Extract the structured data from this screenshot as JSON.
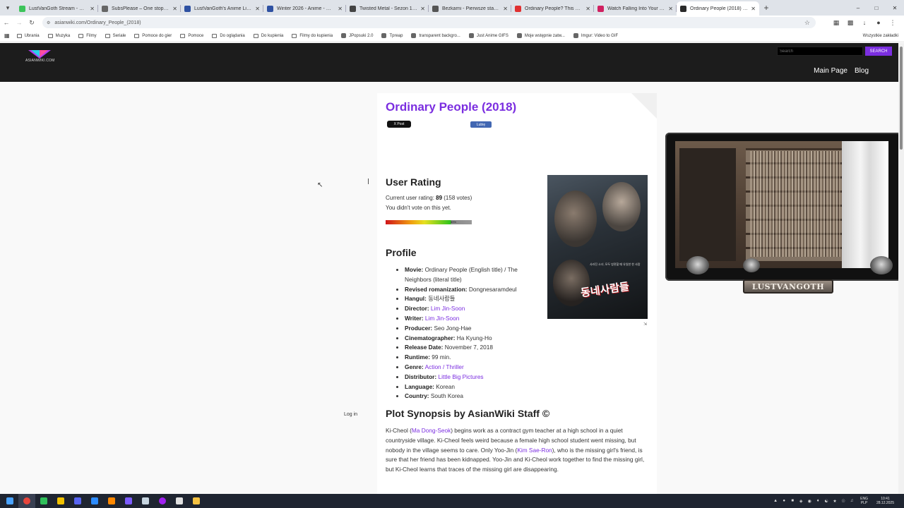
{
  "browser": {
    "tabs": [
      {
        "title": "LustVanGoth Stream - Watch L",
        "color": "#3cc45a",
        "active": false
      },
      {
        "title": "SubsPlease – One stop shop fo",
        "color": "#666666",
        "active": false
      },
      {
        "title": "LustVanGoth's Anime List - My",
        "color": "#2e51a2",
        "active": false
      },
      {
        "title": "Winter 2026 - Anime - MyAnim",
        "color": "#2e51a2",
        "active": false
      },
      {
        "title": "Twisted Metal - Sezon 1 Odcin",
        "color": "#444444",
        "active": false
      },
      {
        "title": "Bezkarni - Pierwsze starcie / Th",
        "color": "#555555",
        "active": false
      },
      {
        "title": "Ordinary People? This Hero PU",
        "color": "#e03030",
        "active": false
      },
      {
        "title": "Watch Falling Into Your Smile E",
        "color": "#d02060",
        "active": false
      },
      {
        "title": "Ordinary People (2018) - Asian",
        "color": "#2a2a2a",
        "active": true
      }
    ],
    "new_tab": "+",
    "url": "asianwiki.com/Ordinary_People_(2018)",
    "bookmarks": [
      {
        "label": "Ubrania",
        "type": "folder"
      },
      {
        "label": "Muzyka",
        "type": "folder"
      },
      {
        "label": "Filmy",
        "type": "folder"
      },
      {
        "label": "Seriale",
        "type": "folder"
      },
      {
        "label": "Pomoce do gier",
        "type": "folder"
      },
      {
        "label": "Pomoce",
        "type": "folder"
      },
      {
        "label": "Do oglądania",
        "type": "folder"
      },
      {
        "label": "Do kupienia",
        "type": "folder"
      },
      {
        "label": "Filmy do kupienia",
        "type": "folder"
      },
      {
        "label": "JPopsuki 2.0",
        "type": "site"
      },
      {
        "label": "Tpreap",
        "type": "site"
      },
      {
        "label": "transparent backgro...",
        "type": "site"
      },
      {
        "label": "Just Anime GIFS",
        "type": "site"
      },
      {
        "label": "Moje wstępnie zatw...",
        "type": "site"
      },
      {
        "label": "Imgur: Video to GIF",
        "type": "site"
      }
    ],
    "bookmarks_other": "Wszystkie zakładki"
  },
  "site": {
    "logo_text": "ASIANWIKI.COM",
    "search_placeholder": "Search",
    "search_button": "SEARCH",
    "nav": [
      "Main Page",
      "Blog"
    ],
    "login": "Log in"
  },
  "article": {
    "title": "Ordinary People (2018)",
    "share_x": "X Post",
    "share_fb": "Lubię",
    "user_rating_heading": "User Rating",
    "rating_line_prefix": "Current user rating: ",
    "rating_value": "89",
    "rating_votes": " (158 votes)",
    "vote_status": "You didn't vote on this yet.",
    "rating_bar_label": "89%",
    "rating_fraction": 0.89,
    "poster_text": "동네사람들",
    "poster_tagline": "사라진 소녀, 모두 방관할 때 유일한 한 사람",
    "profile_heading": "Profile",
    "profile": [
      {
        "key": "Movie:",
        "value": "Ordinary People (English title) / The Neighbors (literal title)",
        "link": false
      },
      {
        "key": "Revised romanization:",
        "value": "Dongnesaramdeul",
        "link": false
      },
      {
        "key": "Hangul:",
        "value": "동네사람들",
        "link": false
      },
      {
        "key": "Director:",
        "value": "Lim Jin-Soon",
        "link": true
      },
      {
        "key": "Writer:",
        "value": "Lim Jin-Soon",
        "link": true
      },
      {
        "key": "Producer:",
        "value": "Seo Jong-Hae",
        "link": false
      },
      {
        "key": "Cinematographer:",
        "value": "Ha Kyung-Ho",
        "link": false
      },
      {
        "key": "Release Date:",
        "value": "November 7, 2018",
        "link": false
      },
      {
        "key": "Runtime:",
        "value": "99 min.",
        "link": false
      },
      {
        "key": "Genre:",
        "value": "Action / Thriller",
        "link": true
      },
      {
        "key": "Distributor:",
        "value": "Little Big Pictures",
        "link": true
      },
      {
        "key": "Language:",
        "value": "Korean",
        "link": false
      },
      {
        "key": "Country:",
        "value": "South Korea",
        "link": false
      }
    ],
    "synopsis_heading": "Plot Synopsis by AsianWiki Staff ©",
    "synopsis": {
      "p1": "Ki-Cheol (",
      "actor1": "Ma Dong-Seok",
      "p2": ") begins work as a contract gym teacher at a high school in a quiet countryside village. Ki-Cheol feels weird because a female high school student went missing, but nobody in the village seems to care. Only Yoo-Jin (",
      "actor2": "Kim Sae-Ron",
      "p3": "), who is the missing girl's friend, is sure that her friend has been kidnapped. Yoo-Jin and Ki-Cheol work together to find the missing girl, but Ki-Cheol learns that traces of the missing girl are disappearing."
    }
  },
  "overlay": {
    "nameplate": "LUSTVANGOTH"
  },
  "taskbar": {
    "apps": [
      {
        "name": "windows-start-icon",
        "color": "#4aa3ff"
      },
      {
        "name": "chrome-icon",
        "color": "#e8453c"
      },
      {
        "name": "green-app-icon",
        "color": "#2fbf5a"
      },
      {
        "name": "triangle-app-icon",
        "color": "#f2c200"
      },
      {
        "name": "discord-icon",
        "color": "#5865f2"
      },
      {
        "name": "blue-square-app-icon",
        "color": "#2d8cff"
      },
      {
        "name": "vlc-icon",
        "color": "#ff8800"
      },
      {
        "name": "browser-app-icon",
        "color": "#7c5cff"
      },
      {
        "name": "steam-icon",
        "color": "#c7d5e0"
      },
      {
        "name": "purple-ring-app-icon",
        "color": "#a020f0"
      },
      {
        "name": "obs-icon",
        "color": "#e0e0e0"
      },
      {
        "name": "folder-icon",
        "color": "#f5c242"
      }
    ],
    "lang_top": "ENG",
    "lang_bottom": "PLP",
    "time": "10:41",
    "date": "28.12.2025"
  }
}
